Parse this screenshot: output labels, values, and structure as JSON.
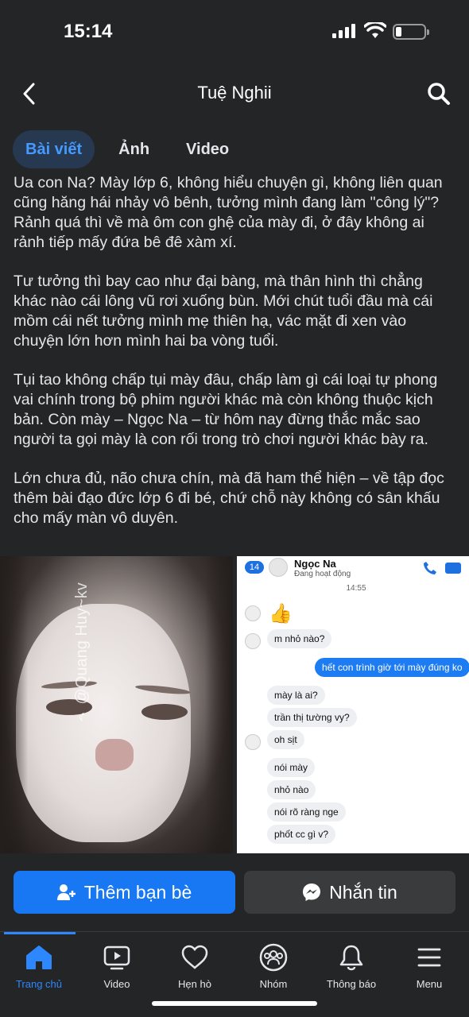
{
  "status_bar": {
    "time": "15:14"
  },
  "header": {
    "title": "Tuệ Nghii"
  },
  "tabs": [
    {
      "label": "Bài viết",
      "active": true
    },
    {
      "label": "Ảnh",
      "active": false
    },
    {
      "label": "Video",
      "active": false
    }
  ],
  "post": {
    "paragraphs": [
      "Ua con Na? Mày lớp 6, không hiểu chuyện gì, không liên quan cũng hăng hái nhảy vô bênh, tưởng mình đang làm \"công lý\"? Rảnh quá thì về mà ôm con ghệ của mày đi, ở đây không ai rảnh tiếp mấy đứa bê đê xàm xí.",
      "Tư tưởng thì bay cao như đại bàng, mà thân hình thì chẳng khác nào cái lông vũ rơi xuống bùn. Mới chút tuổi đầu mà cái mồm cái nết tưởng mình mẹ thiên hạ, vác mặt đi xen vào chuyện lớn hơn mình hai ba vòng tuổi.",
      "Tụi tao không chấp tụi mày đâu, chấp làm gì cái loại tự phong vai chính trong bộ phim người khác mà còn không thuộc kịch bản. Còn mày – Ngọc Na – từ hôm nay đừng thắc mắc sao người ta gọi mày là con rối trong trò chơi người khác bày ra.",
      "Lớn chưa đủ, não chưa chín, mà đã ham thể hiện – về tập đọc thêm bài đạo đức lớp 6 đi bé, chứ chỗ này không có sân khấu cho mấy màn vô duyên."
    ],
    "photo_watermark": "♪ @Quang Huy~kv",
    "chat": {
      "back_count": "14",
      "name": "Ngọc Na",
      "status": "Đang hoạt động",
      "time": "14:55",
      "messages": [
        {
          "text": "m nhỏ nào?",
          "from": "in"
        },
        {
          "text": "hết con trình giờ tới mày đúng ko",
          "from": "out"
        },
        {
          "text": "mày là ai?",
          "from": "in"
        },
        {
          "text": "trần thị tường vy?",
          "from": "in"
        },
        {
          "text": "oh sịt",
          "from": "in"
        },
        {
          "text": "nói mày",
          "from": "in"
        },
        {
          "text": "nhỏ nào",
          "from": "in"
        },
        {
          "text": "nói rõ ràng nge",
          "from": "in"
        },
        {
          "text": "phốt cc gì v?",
          "from": "in"
        }
      ]
    }
  },
  "actions": {
    "add_friend": "Thêm bạn bè",
    "message": "Nhắn tin"
  },
  "bottom_nav": [
    {
      "label": "Trang chủ",
      "icon": "home-icon",
      "active": true
    },
    {
      "label": "Video",
      "icon": "video-icon",
      "active": false
    },
    {
      "label": "Hẹn hò",
      "icon": "heart-icon",
      "active": false
    },
    {
      "label": "Nhóm",
      "icon": "groups-icon",
      "active": false
    },
    {
      "label": "Thông báo",
      "icon": "bell-icon",
      "active": false
    },
    {
      "label": "Menu",
      "icon": "menu-icon",
      "active": false
    }
  ],
  "colors": {
    "background": "#242526",
    "accent": "#1877f2",
    "active_tab_bg": "#263951",
    "active_tab_text": "#4599ff"
  }
}
